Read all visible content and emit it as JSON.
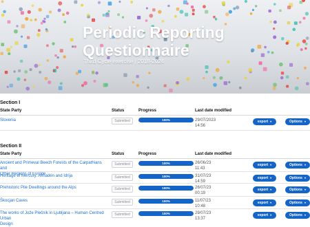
{
  "hero": {
    "title": "Periodic Reporting Questionnaire",
    "subtitle": "Third Cycle exercise | 2018-2024"
  },
  "columns": {
    "state_party": "State Party",
    "status": "Status",
    "progress": "Progress",
    "last_modified": "Last date modified"
  },
  "buttons": {
    "export_label": "export",
    "options_label": "Options",
    "caret": "▾"
  },
  "section1": {
    "title": "Section I",
    "rows": [
      {
        "name": "Slovenia",
        "status": "Submitted",
        "progress": 1.0,
        "progress_label": "100%",
        "date": "29/07/2023",
        "time": "14:56"
      }
    ]
  },
  "section2": {
    "title": "Section II",
    "rows": [
      {
        "name_line1": "Ancient and Primeval Beech Forests of the Carpathians and",
        "name_line2": "Other Regions of Europe",
        "status": "Submitted",
        "progress": 1.0,
        "progress_label": "100%",
        "date": "26/06/23",
        "time": "11:43"
      },
      {
        "name_line1": "Heritage of Mercury. Almadén and Idrija",
        "name_line2": "",
        "status": "Submitted",
        "progress": 1.0,
        "progress_label": "100%",
        "date": "31/07/23",
        "time": "14:59"
      },
      {
        "name_line1": "Prehistoric Pile Dwellings around the Alps",
        "name_line2": "",
        "status": "Submitted",
        "progress": 1.0,
        "progress_label": "100%",
        "date": "26/07/23",
        "time": "00:19"
      },
      {
        "name_line1": "Škocjan Caves",
        "name_line2": "",
        "status": "Submitted",
        "progress": 1.0,
        "progress_label": "100%",
        "date": "11/07/23",
        "time": "10:48"
      },
      {
        "name_line1": "The works of Jože Plečnik in Ljubljana – Human Centred Urban",
        "name_line2": "Design",
        "status": "Submitted",
        "progress": 1.0,
        "progress_label": "100%",
        "date": "29/07/23",
        "time": "13:37"
      }
    ]
  },
  "colors": {
    "accent": "#1565c8",
    "link": "#1a6fd1",
    "hero_bg": "#dfe2e6"
  }
}
